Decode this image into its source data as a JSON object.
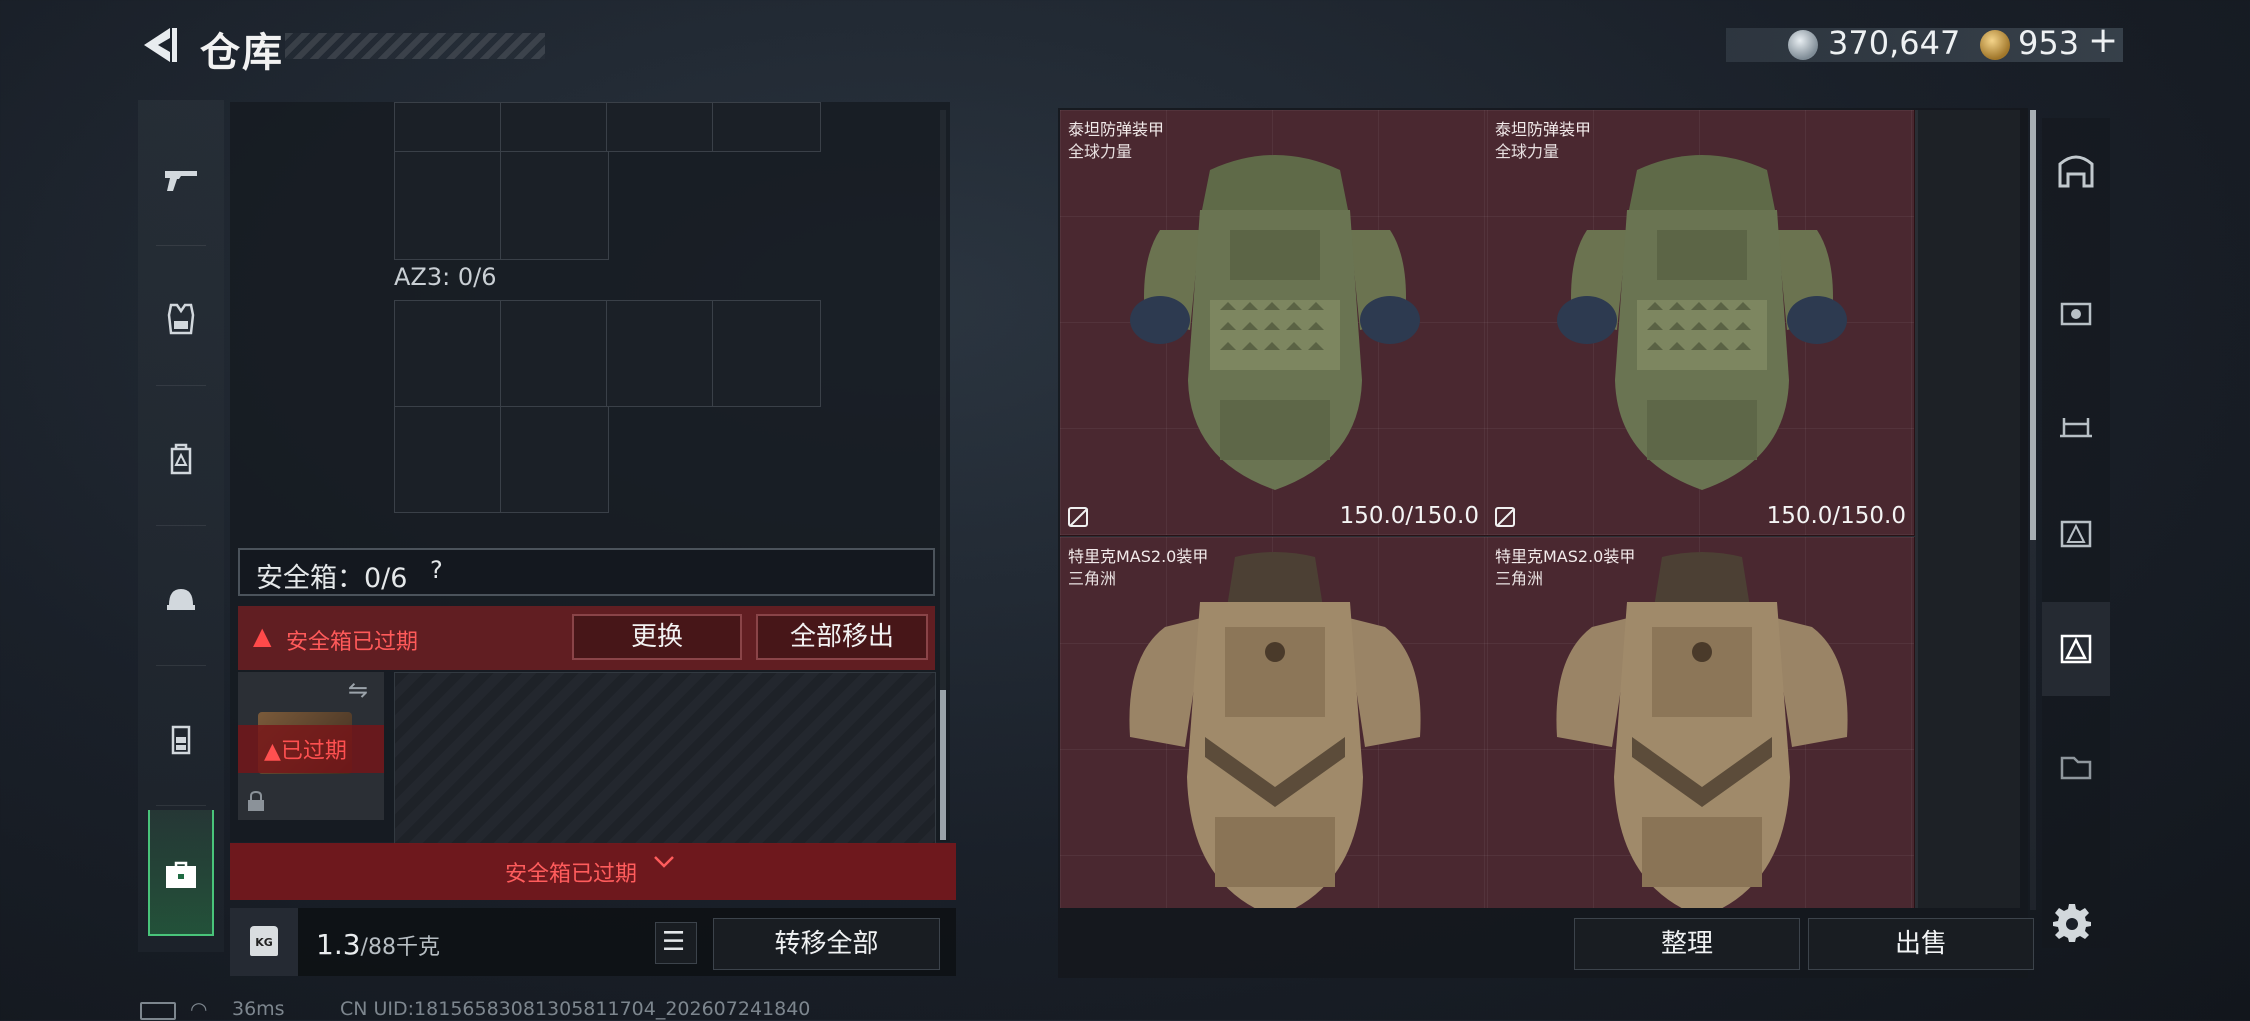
{
  "header": {
    "title": "仓库",
    "currency": [
      {
        "icon": "silver-coin-icon",
        "value": "370,647"
      },
      {
        "icon": "gold-coin-icon",
        "value": "953",
        "add": "+"
      }
    ]
  },
  "left_sidebar": {
    "items": [
      {
        "name": "weapons",
        "icon": "pistol-icon",
        "glyph": "⌐"
      },
      {
        "name": "armor",
        "icon": "vest-icon",
        "glyph": "▦"
      },
      {
        "name": "backpack",
        "icon": "backpack-icon",
        "glyph": "◘"
      },
      {
        "name": "helmet",
        "icon": "helmet-icon",
        "glyph": "◓"
      },
      {
        "name": "rig",
        "icon": "rig-icon",
        "glyph": "▤"
      },
      {
        "name": "safe-case",
        "icon": "briefcase-icon",
        "glyph": "▬"
      }
    ]
  },
  "loadout": {
    "az3_label": "AZ3: 0/6",
    "safe_box_label": "安全箱：0/6",
    "help": "?",
    "expired_notice": "安全箱已过期",
    "replace_btn": "更换",
    "move_all_btn": "全部移出",
    "case_expired_tag": "已过期",
    "case_expired_bar": "安全箱已过期",
    "chevron": "⌄"
  },
  "weight": {
    "icon_text": "KG",
    "value": "1.3",
    "unit": "/88千克"
  },
  "transfer_all_btn": "转移全部",
  "list_icon": "☰",
  "status_bar": {
    "ping": "36ms",
    "uid": "CN UID:18156583081305811704_202607241840"
  },
  "storage": {
    "items": [
      {
        "name": "泰坦防弹装甲",
        "sub": "全球力量",
        "durability": "150.0/150.0",
        "type": "titan"
      },
      {
        "name": "泰坦防弹装甲",
        "sub": "全球力量",
        "durability": "150.0/150.0",
        "type": "titan"
      },
      {
        "name": "特里克MAS2.0装甲",
        "sub": "三角洲",
        "durability": "",
        "type": "trek"
      },
      {
        "name": "特里克MAS2.0装甲",
        "sub": "三角洲",
        "durability": "",
        "type": "trek"
      }
    ],
    "sort_btn": "整理",
    "sell_btn": "出售"
  },
  "right_sidebar": {
    "items": [
      {
        "name": "storage-main",
        "icon": "vault-icon",
        "glyph": "⌂",
        "active": false
      },
      {
        "name": "storage-4",
        "icon": "storage-iv-icon",
        "glyph": "▣",
        "active": false
      },
      {
        "name": "storage-3",
        "icon": "storage-iii-icon",
        "glyph": "▥",
        "active": false
      },
      {
        "name": "storage-2",
        "icon": "storage-ii-icon",
        "glyph": "▧",
        "active": false
      },
      {
        "name": "storage-g",
        "icon": "storage-g-icon",
        "glyph": "◬",
        "active": true
      },
      {
        "name": "storage-1",
        "icon": "storage-i-icon",
        "glyph": "▨",
        "active": false
      }
    ]
  },
  "colors": {
    "expired_red": "#ff4a4a",
    "selected_green": "#49c47a",
    "item_bg": "#4a2830"
  }
}
